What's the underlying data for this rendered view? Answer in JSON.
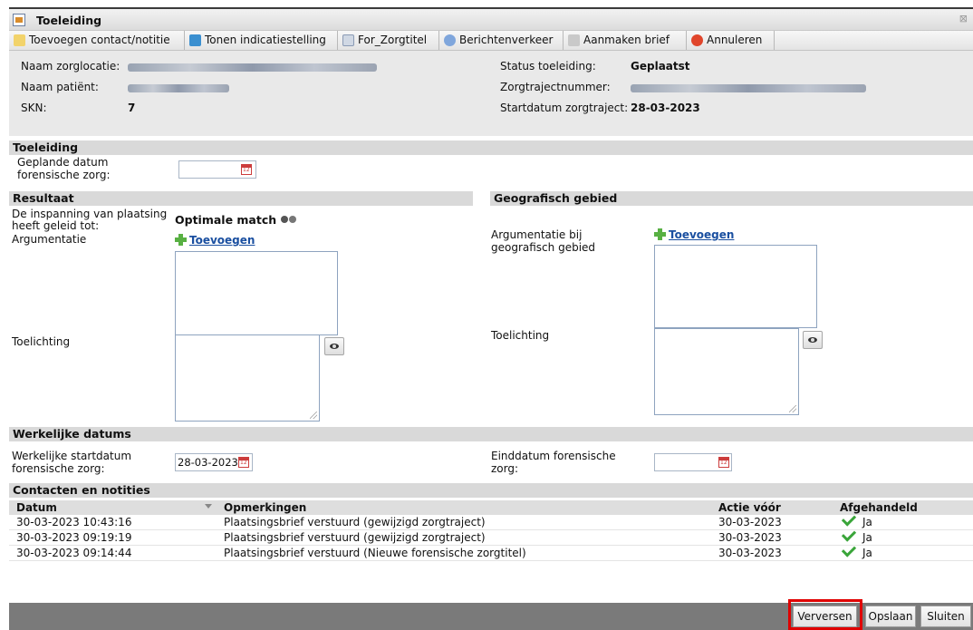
{
  "window": {
    "title": "Toeleiding"
  },
  "toolbar": {
    "add_contact": "Toevoegen contact/notitie",
    "show_indication": "Tonen indicatiestelling",
    "for_zorgtitel": "For_Zorgtitel",
    "messages": "Berichtenverkeer",
    "create_letter": "Aanmaken brief",
    "cancel": "Annuleren"
  },
  "info": {
    "naam_zorglocatie_label": "Naam zorglocatie:",
    "naam_patient_label": "Naam patiënt:",
    "skn_label": "SKN:",
    "skn_value": "7",
    "status_label": "Status toeleiding:",
    "status_value": "Geplaatst",
    "zorgtraject_label": "Zorgtrajectnummer:",
    "startdatum_label": "Startdatum zorgtraject:",
    "startdatum_value": "28-03-2023"
  },
  "toeleiding": {
    "header": "Toeleiding",
    "geplande_label_1": "Geplande datum",
    "geplande_label_2": "forensische zorg:"
  },
  "resultaat": {
    "header": "Resultaat",
    "inspanning_1": "De inspanning van plaatsing",
    "inspanning_2": "heeft geleid tot:",
    "match_value": "Optimale match",
    "argumentatie_label": "Argumentatie",
    "add_link": "Toevoegen",
    "toelichting_label": "Toelichting"
  },
  "geografisch": {
    "header": "Geografisch gebied",
    "argumentatie_1": "Argumentatie bij",
    "argumentatie_2": "geografisch gebied",
    "add_link": "Toevoegen",
    "toelichting_label": "Toelichting"
  },
  "werkelijke": {
    "header": "Werkelijke datums",
    "start_label_1": "Werkelijke startdatum",
    "start_label_2": "forensische zorg:",
    "start_value": "28-03-2023",
    "eind_label_1": "Einddatum forensische",
    "eind_label_2": "zorg:"
  },
  "contacten": {
    "header": "Contacten en notities",
    "columns": {
      "datum": "Datum",
      "opmerkingen": "Opmerkingen",
      "actie": "Actie vóór",
      "afgehandeld": "Afgehandeld"
    },
    "rows": [
      {
        "datum": "30-03-2023 10:43:16",
        "opmerking": "Plaatsingsbrief verstuurd (gewijzigd zorgtraject)",
        "actie": "30-03-2023",
        "afgehandeld": "Ja"
      },
      {
        "datum": "30-03-2023 09:19:19",
        "opmerking": "Plaatsingsbrief verstuurd (gewijzigd zorgtraject)",
        "actie": "30-03-2023",
        "afgehandeld": "Ja"
      },
      {
        "datum": "30-03-2023 09:14:44",
        "opmerking": "Plaatsingsbrief verstuurd (Nieuwe forensische zorgtitel)",
        "actie": "30-03-2023",
        "afgehandeld": "Ja"
      }
    ]
  },
  "footer": {
    "refresh": "Verversen",
    "save": "Opslaan",
    "close": "Sluiten"
  },
  "colors": {
    "highlight": "#e00000",
    "link": "#1a4fa0",
    "check": "#3aa53a"
  }
}
